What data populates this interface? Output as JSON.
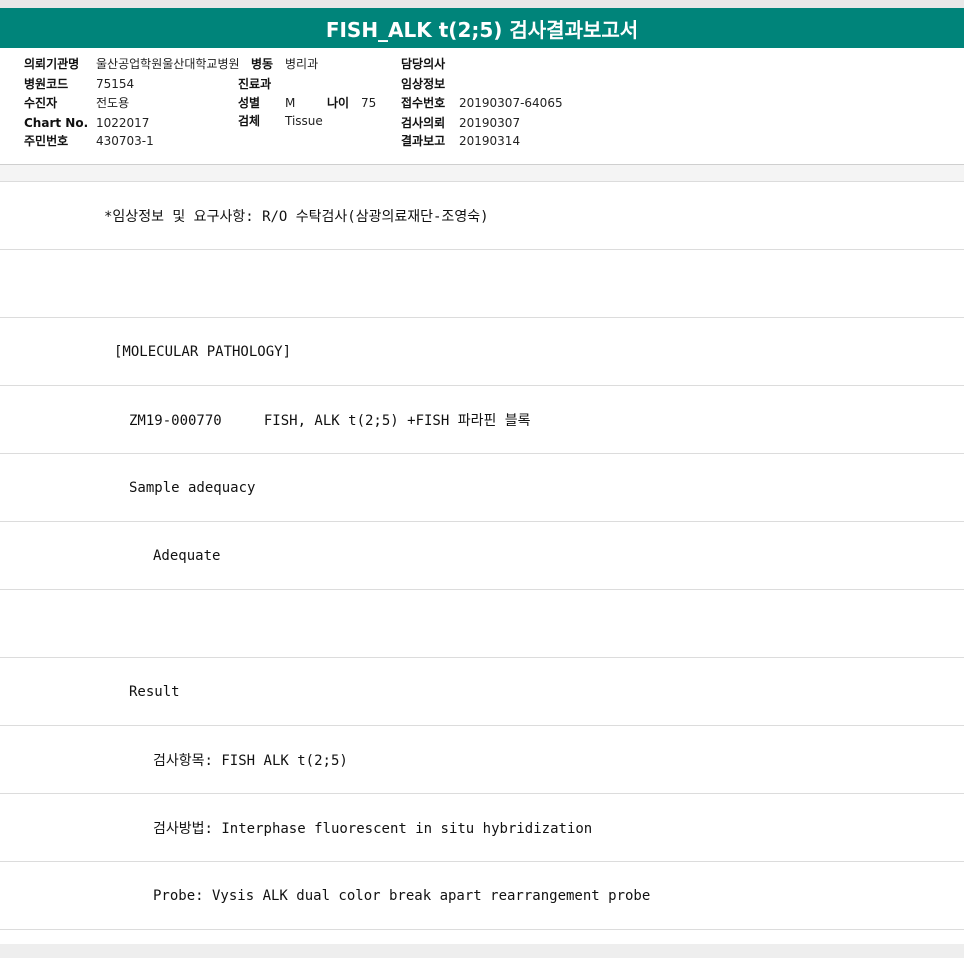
{
  "title": "FISH_ALK t(2;5) 검사결과보고서",
  "header": {
    "institution_label": "의뢰기관명",
    "institution_value": "울산공업학원울산대학교병원",
    "ward_label": "병동",
    "ward_value": "병리과",
    "doctor_label": "담당의사",
    "doctor_value": "",
    "hospital_code_label": "병원코드",
    "hospital_code_value": "75154",
    "department_label": "진료과",
    "department_value": "",
    "clinical_info_label": "임상정보",
    "clinical_info_value": "",
    "recipient_label": "수진자",
    "recipient_value": "전도용",
    "sex_label": "성별",
    "sex_value": "M",
    "age_label": "나이",
    "age_value": "75",
    "receipt_label": "접수번호",
    "receipt_value": "20190307-64065",
    "chart_label": "Chart No.",
    "chart_value": "1022017",
    "specimen_label": "검체",
    "specimen_value": "Tissue",
    "request_label": "검사의뢰",
    "request_value": "20190307",
    "resident_label": "주민번호",
    "resident_value": "430703-1",
    "report_label": "결과보고",
    "report_value": "20190314"
  },
  "report_lines": [
    "*임상정보 및 요구사항: R/O 수탁검사(삼광의료재단-조영숙)",
    "",
    "[MOLECULAR PATHOLOGY]",
    "ZM19-000770     FISH, ALK t(2;5) +FISH 파라핀 블록",
    "Sample adequacy",
    "Adequate",
    "",
    "Result",
    "검사항목: FISH ALK t(2;5)",
    "검사방법: Interphase fluorescent in situ hybridization",
    "Probe: Vysis ALK dual color break apart rearrangement probe"
  ]
}
